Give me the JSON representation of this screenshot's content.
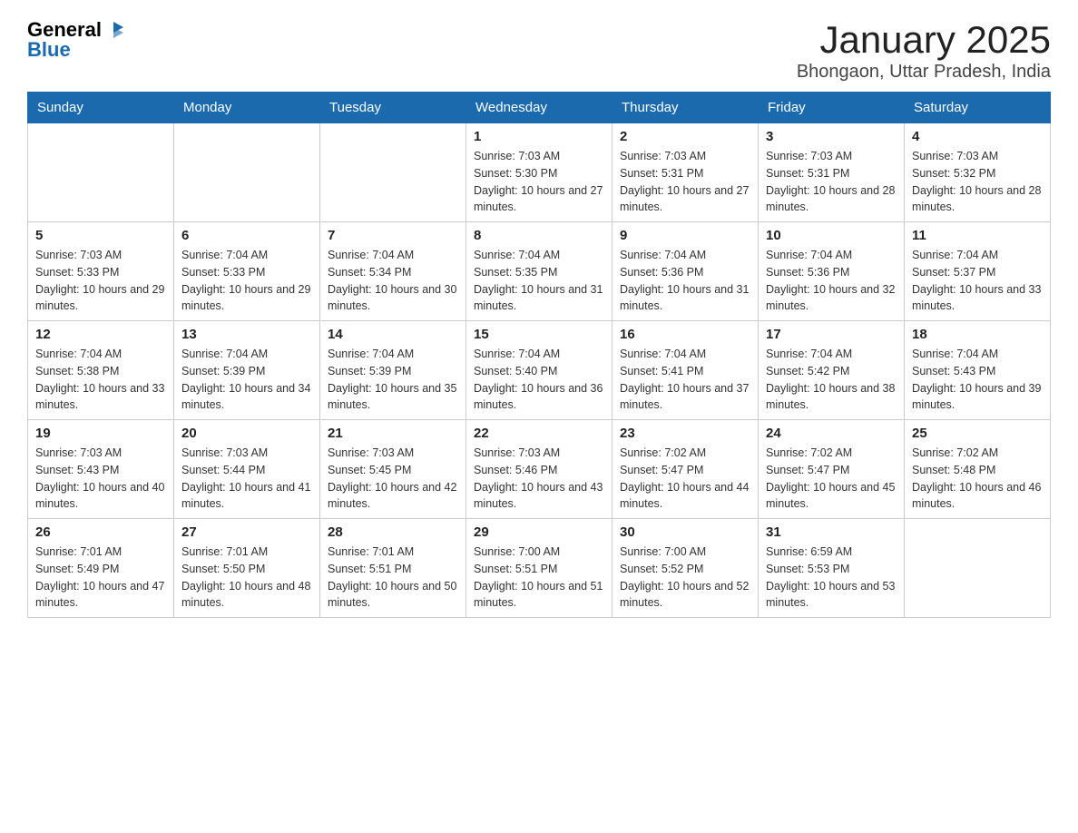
{
  "header": {
    "logo": {
      "general": "General",
      "blue": "Blue"
    },
    "title": "January 2025",
    "subtitle": "Bhongaon, Uttar Pradesh, India"
  },
  "days_of_week": [
    "Sunday",
    "Monday",
    "Tuesday",
    "Wednesday",
    "Thursday",
    "Friday",
    "Saturday"
  ],
  "weeks": [
    [
      {
        "day": "",
        "info": ""
      },
      {
        "day": "",
        "info": ""
      },
      {
        "day": "",
        "info": ""
      },
      {
        "day": "1",
        "info": "Sunrise: 7:03 AM\nSunset: 5:30 PM\nDaylight: 10 hours and 27 minutes."
      },
      {
        "day": "2",
        "info": "Sunrise: 7:03 AM\nSunset: 5:31 PM\nDaylight: 10 hours and 27 minutes."
      },
      {
        "day": "3",
        "info": "Sunrise: 7:03 AM\nSunset: 5:31 PM\nDaylight: 10 hours and 28 minutes."
      },
      {
        "day": "4",
        "info": "Sunrise: 7:03 AM\nSunset: 5:32 PM\nDaylight: 10 hours and 28 minutes."
      }
    ],
    [
      {
        "day": "5",
        "info": "Sunrise: 7:03 AM\nSunset: 5:33 PM\nDaylight: 10 hours and 29 minutes."
      },
      {
        "day": "6",
        "info": "Sunrise: 7:04 AM\nSunset: 5:33 PM\nDaylight: 10 hours and 29 minutes."
      },
      {
        "day": "7",
        "info": "Sunrise: 7:04 AM\nSunset: 5:34 PM\nDaylight: 10 hours and 30 minutes."
      },
      {
        "day": "8",
        "info": "Sunrise: 7:04 AM\nSunset: 5:35 PM\nDaylight: 10 hours and 31 minutes."
      },
      {
        "day": "9",
        "info": "Sunrise: 7:04 AM\nSunset: 5:36 PM\nDaylight: 10 hours and 31 minutes."
      },
      {
        "day": "10",
        "info": "Sunrise: 7:04 AM\nSunset: 5:36 PM\nDaylight: 10 hours and 32 minutes."
      },
      {
        "day": "11",
        "info": "Sunrise: 7:04 AM\nSunset: 5:37 PM\nDaylight: 10 hours and 33 minutes."
      }
    ],
    [
      {
        "day": "12",
        "info": "Sunrise: 7:04 AM\nSunset: 5:38 PM\nDaylight: 10 hours and 33 minutes."
      },
      {
        "day": "13",
        "info": "Sunrise: 7:04 AM\nSunset: 5:39 PM\nDaylight: 10 hours and 34 minutes."
      },
      {
        "day": "14",
        "info": "Sunrise: 7:04 AM\nSunset: 5:39 PM\nDaylight: 10 hours and 35 minutes."
      },
      {
        "day": "15",
        "info": "Sunrise: 7:04 AM\nSunset: 5:40 PM\nDaylight: 10 hours and 36 minutes."
      },
      {
        "day": "16",
        "info": "Sunrise: 7:04 AM\nSunset: 5:41 PM\nDaylight: 10 hours and 37 minutes."
      },
      {
        "day": "17",
        "info": "Sunrise: 7:04 AM\nSunset: 5:42 PM\nDaylight: 10 hours and 38 minutes."
      },
      {
        "day": "18",
        "info": "Sunrise: 7:04 AM\nSunset: 5:43 PM\nDaylight: 10 hours and 39 minutes."
      }
    ],
    [
      {
        "day": "19",
        "info": "Sunrise: 7:03 AM\nSunset: 5:43 PM\nDaylight: 10 hours and 40 minutes."
      },
      {
        "day": "20",
        "info": "Sunrise: 7:03 AM\nSunset: 5:44 PM\nDaylight: 10 hours and 41 minutes."
      },
      {
        "day": "21",
        "info": "Sunrise: 7:03 AM\nSunset: 5:45 PM\nDaylight: 10 hours and 42 minutes."
      },
      {
        "day": "22",
        "info": "Sunrise: 7:03 AM\nSunset: 5:46 PM\nDaylight: 10 hours and 43 minutes."
      },
      {
        "day": "23",
        "info": "Sunrise: 7:02 AM\nSunset: 5:47 PM\nDaylight: 10 hours and 44 minutes."
      },
      {
        "day": "24",
        "info": "Sunrise: 7:02 AM\nSunset: 5:47 PM\nDaylight: 10 hours and 45 minutes."
      },
      {
        "day": "25",
        "info": "Sunrise: 7:02 AM\nSunset: 5:48 PM\nDaylight: 10 hours and 46 minutes."
      }
    ],
    [
      {
        "day": "26",
        "info": "Sunrise: 7:01 AM\nSunset: 5:49 PM\nDaylight: 10 hours and 47 minutes."
      },
      {
        "day": "27",
        "info": "Sunrise: 7:01 AM\nSunset: 5:50 PM\nDaylight: 10 hours and 48 minutes."
      },
      {
        "day": "28",
        "info": "Sunrise: 7:01 AM\nSunset: 5:51 PM\nDaylight: 10 hours and 50 minutes."
      },
      {
        "day": "29",
        "info": "Sunrise: 7:00 AM\nSunset: 5:51 PM\nDaylight: 10 hours and 51 minutes."
      },
      {
        "day": "30",
        "info": "Sunrise: 7:00 AM\nSunset: 5:52 PM\nDaylight: 10 hours and 52 minutes."
      },
      {
        "day": "31",
        "info": "Sunrise: 6:59 AM\nSunset: 5:53 PM\nDaylight: 10 hours and 53 minutes."
      },
      {
        "day": "",
        "info": ""
      }
    ]
  ]
}
